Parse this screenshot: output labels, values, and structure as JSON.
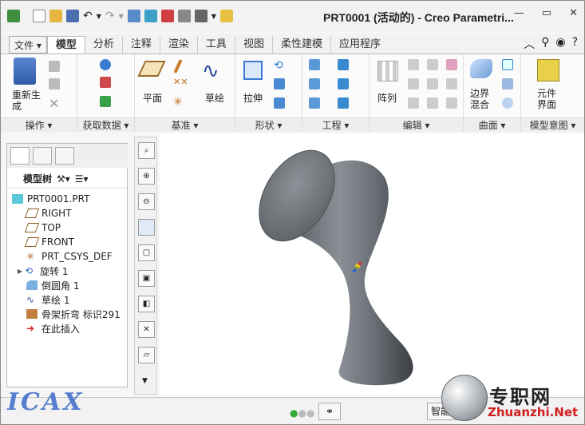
{
  "window": {
    "title": "PRT0001 (活动的) - Creo Parametri..."
  },
  "menu_tabs": [
    {
      "label": "文件"
    },
    {
      "label": "模型"
    },
    {
      "label": "分析"
    },
    {
      "label": "注释"
    },
    {
      "label": "渲染"
    },
    {
      "label": "工具"
    },
    {
      "label": "视图"
    },
    {
      "label": "柔性建模"
    },
    {
      "label": "应用程序"
    }
  ],
  "ribbon": {
    "groups": [
      {
        "label": "操作",
        "buttons": [
          "重新生成"
        ]
      },
      {
        "label": "获取数据",
        "buttons": []
      },
      {
        "label": "基准",
        "buttons": [
          "平面",
          "草绘"
        ]
      },
      {
        "label": "形状",
        "buttons": [
          "拉伸"
        ]
      },
      {
        "label": "工程",
        "buttons": []
      },
      {
        "label": "编辑",
        "buttons": [
          "阵列"
        ]
      },
      {
        "label": "曲面",
        "buttons": [
          "边界混合"
        ]
      },
      {
        "label": "模型意图",
        "buttons": [
          "元件界面"
        ]
      }
    ]
  },
  "model_tree": {
    "header": "模型树",
    "items": [
      {
        "label": "PRT0001.PRT",
        "icon": "part-icon"
      },
      {
        "label": "RIGHT",
        "icon": "datum-plane-icon"
      },
      {
        "label": "TOP",
        "icon": "datum-plane-icon"
      },
      {
        "label": "FRONT",
        "icon": "datum-plane-icon"
      },
      {
        "label": "PRT_CSYS_DEF",
        "icon": "csys-icon"
      },
      {
        "label": "旋转 1",
        "icon": "revolve-icon",
        "expandable": true
      },
      {
        "label": "倒圆角 1",
        "icon": "round-icon"
      },
      {
        "label": "草绘 1",
        "icon": "sketch-icon"
      },
      {
        "label": "骨架折弯 标识291",
        "icon": "spinal-bend-icon"
      },
      {
        "label": "在此插入",
        "icon": "insert-here-icon"
      }
    ]
  },
  "status": {
    "smart_select": "智能"
  },
  "watermark": {
    "site_cn": "专职网",
    "site_url": "Zhuanzhi.Net",
    "logo_text": "ICAX"
  },
  "colors": {
    "model_gray": "#6f747a",
    "accent": "#1e6fd0"
  }
}
